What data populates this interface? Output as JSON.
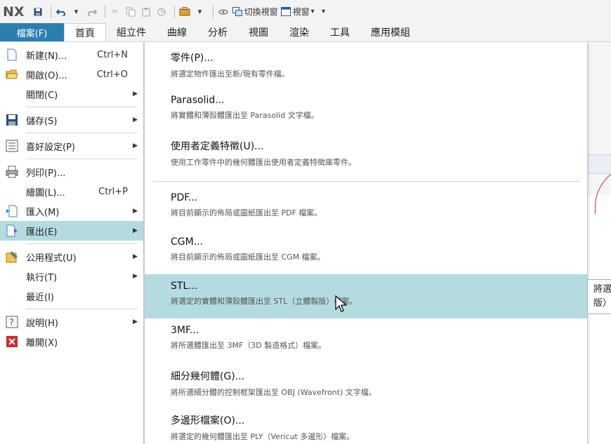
{
  "qat": {
    "logo": "NX",
    "switch_window_label": "切換視窗",
    "window_label": "視窗"
  },
  "ribbon": {
    "file_tab": "檔案(F)",
    "tabs": [
      "首頁",
      "組立件",
      "曲線",
      "分析",
      "視圖",
      "渲染",
      "工具",
      "應用模組"
    ]
  },
  "file_menu": {
    "items": [
      {
        "label": "新建(N)...",
        "shortcut": "Ctrl+N",
        "icon": "new-file-icon"
      },
      {
        "label": "開啟(O)...",
        "shortcut": "Ctrl+O",
        "icon": "open-folder-icon"
      },
      {
        "label": "關閉(C)",
        "submenu": true
      },
      {
        "label": "儲存(S)",
        "submenu": true,
        "icon": "save-icon"
      },
      {
        "label": "喜好設定(P)",
        "submenu": true,
        "icon": "preferences-icon"
      },
      {
        "label": "列印(P)...",
        "icon": "print-icon"
      },
      {
        "label": "繪圖(L)...",
        "shortcut": "Ctrl+P"
      },
      {
        "label": "匯入(M)",
        "submenu": true,
        "icon": "import-icon"
      },
      {
        "label": "匯出(E)",
        "submenu": true,
        "icon": "export-icon",
        "highlighted": true
      },
      {
        "label": "公用程式(U)",
        "submenu": true,
        "icon": "utilities-icon"
      },
      {
        "label": "執行(T)",
        "submenu": true
      },
      {
        "label": "最近(I)"
      },
      {
        "label": "說明(H)",
        "submenu": true,
        "icon": "help-icon"
      },
      {
        "label": "離開(X)",
        "icon": "exit-icon"
      }
    ]
  },
  "export_menu": {
    "items": [
      {
        "title": "零件(P)...",
        "desc": "將選定物件匯出至新/現有零件檔。"
      },
      {
        "title": "Parasolid...",
        "desc": "將實體和薄殼體匯出至 Parasolid 文字檔。"
      },
      {
        "title": "使用者定義特徵(U)...",
        "desc": "使用工作零件中的幾何體匯出使用者定義特徵庫零件。"
      },
      {
        "title": "PDF...",
        "desc": "將目前顯示的佈局或圖紙匯出至 PDF 檔案。"
      },
      {
        "title": "CGM...",
        "desc": "將目前顯示的佈局或圖紙匯出至 CGM 檔案。"
      },
      {
        "title": "STL...",
        "desc": "將選定的實體和薄殼體匯出至 STL（立體製版）檔案。",
        "highlighted": true
      },
      {
        "title": "3MF...",
        "desc": "將所選體匯出至 3MF（3D 製造格式）檔案。"
      },
      {
        "title": "細分幾何體(G)...",
        "desc": "將所選細分體的控制框架匯出至 OBJ (Wavefront) 文字檔。"
      },
      {
        "title": "多邊形檔案(O)...",
        "desc": "將選定的幾何體匯出至 PLY（Vericut 多邊形）檔案。"
      }
    ]
  },
  "tooltip": {
    "line1": "將選",
    "line2": "版）"
  },
  "colors": {
    "file_tab_bg": "#2a7fb0",
    "highlight": "#b4dce0"
  }
}
